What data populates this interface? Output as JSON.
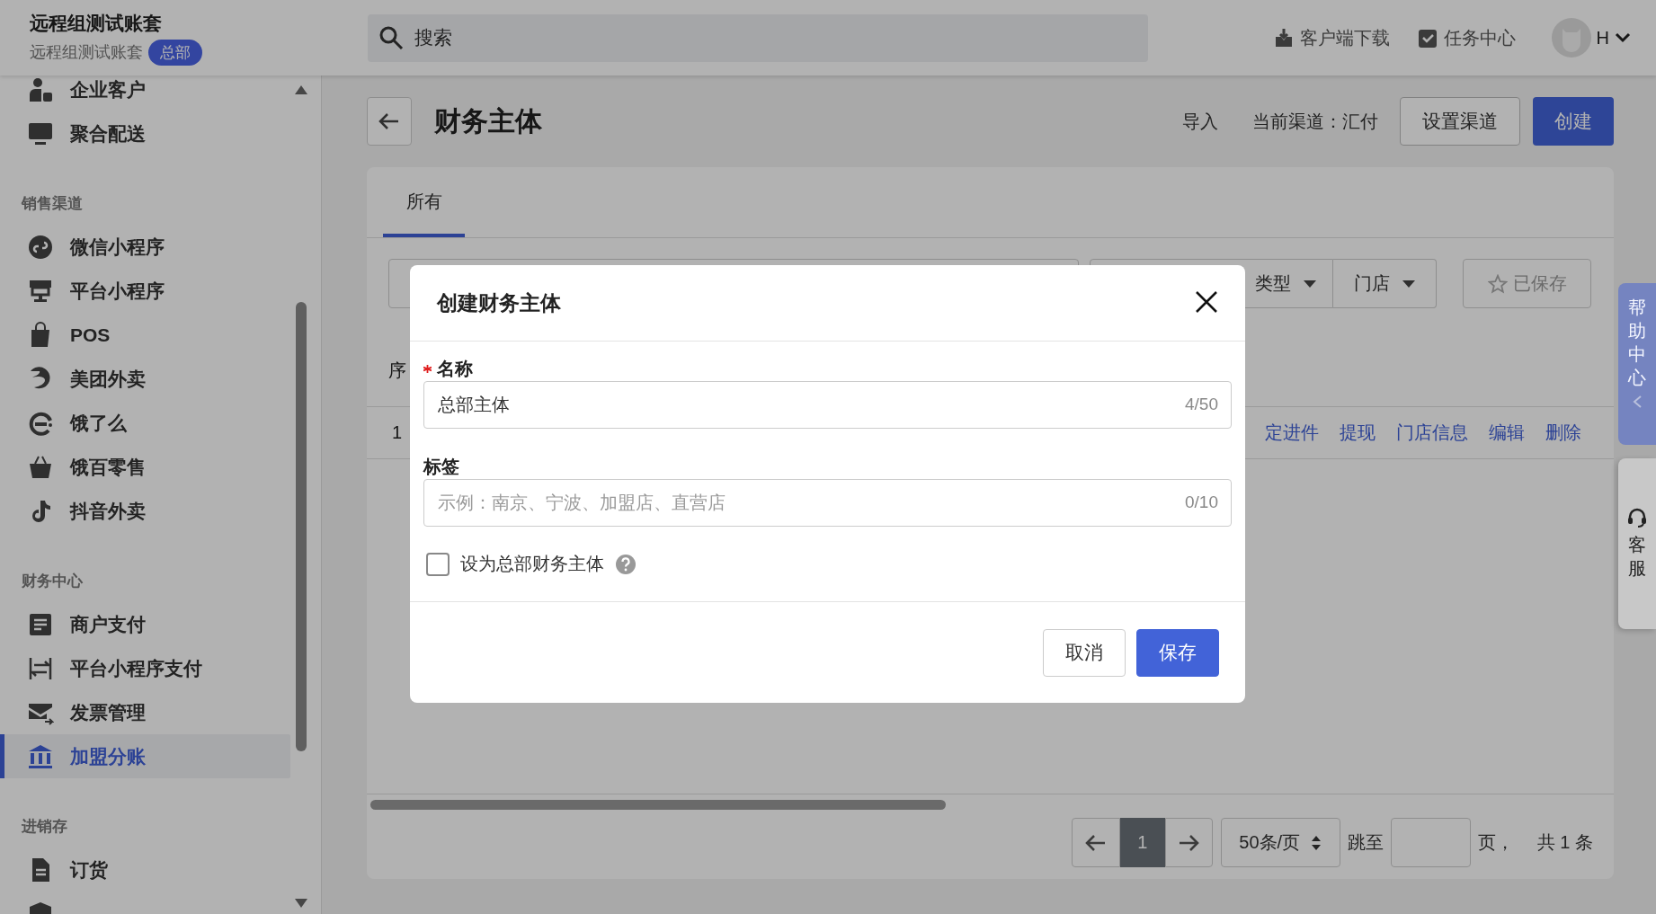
{
  "header": {
    "account_name": "远程组测试账套",
    "account_subtitle": "远程组测试账套",
    "account_badge": "总部"
  },
  "topbar": {
    "search": {
      "placeholder": "搜索"
    },
    "actions": [
      {
        "label": "客户端下载"
      },
      {
        "label": "任务中心"
      }
    ],
    "user": {
      "initial": "H"
    }
  },
  "sidebar": {
    "sections": [
      {
        "items": [
          {
            "label": "企业客户",
            "selected": false
          },
          {
            "label": "聚合配送",
            "selected": false
          }
        ]
      },
      {
        "title": "销售渠道",
        "items": [
          {
            "label": "微信小程序",
            "selected": false
          },
          {
            "label": "平台小程序",
            "selected": false
          },
          {
            "label": "POS",
            "selected": false
          },
          {
            "label": "美团外卖",
            "selected": false
          },
          {
            "label": "饿了么",
            "selected": false
          },
          {
            "label": "饿百零售",
            "selected": false
          },
          {
            "label": "抖音外卖",
            "selected": false
          }
        ]
      },
      {
        "title": "财务中心",
        "items": [
          {
            "label": "商户支付",
            "selected": false
          },
          {
            "label": "平台小程序支付",
            "selected": false
          },
          {
            "label": "发票管理",
            "selected": false
          },
          {
            "label": "加盟分账",
            "selected": true
          }
        ]
      },
      {
        "title": "进销存",
        "items": [
          {
            "label": "订货",
            "selected": false
          },
          {
            "selected": false
          }
        ]
      }
    ]
  },
  "page": {
    "title": "财务主体",
    "actions": [
      {
        "kind": "link",
        "label": "导入"
      },
      {
        "kind": "text",
        "label": "当前渠道：汇付"
      },
      {
        "kind": "button",
        "label": "设置渠道"
      },
      {
        "kind": "primary",
        "label": "创建"
      }
    ]
  },
  "tabs": [
    {
      "label": "所有",
      "selected": true
    }
  ],
  "filters": {
    "dropdowns": [
      {
        "label": "类型"
      },
      {
        "label": "门店"
      }
    ],
    "saved_button": "已保存"
  },
  "table": {
    "columns": [
      {
        "label": "序"
      }
    ],
    "rows": [
      {
        "index": "1",
        "actions": [
          "定进件",
          "提现",
          "门店信息",
          "编辑",
          "删除"
        ]
      }
    ]
  },
  "pagination": {
    "pages": [
      {
        "label": "1",
        "selected": true
      }
    ],
    "page_size": "50条/页",
    "jump_label": "跳至",
    "page_suffix": "页，",
    "total": "共 1 条"
  },
  "side_tabs": [
    {
      "kind": "help",
      "label": "帮助中心"
    },
    {
      "kind": "service",
      "label": "客服"
    }
  ],
  "dialog": {
    "title": "创建财务主体",
    "fields": [
      {
        "label": "名称",
        "required": true,
        "value": "总部主体",
        "counter": "4/50"
      },
      {
        "label": "标签",
        "required": false,
        "placeholder": "示例：南京、宁波、加盟店、直营店",
        "counter": "0/10"
      }
    ],
    "checkbox": {
      "label": "设为总部财务主体",
      "checked": false
    },
    "buttons": [
      {
        "kind": "secondary",
        "label": "取消"
      },
      {
        "kind": "primary",
        "label": "保存"
      }
    ]
  }
}
